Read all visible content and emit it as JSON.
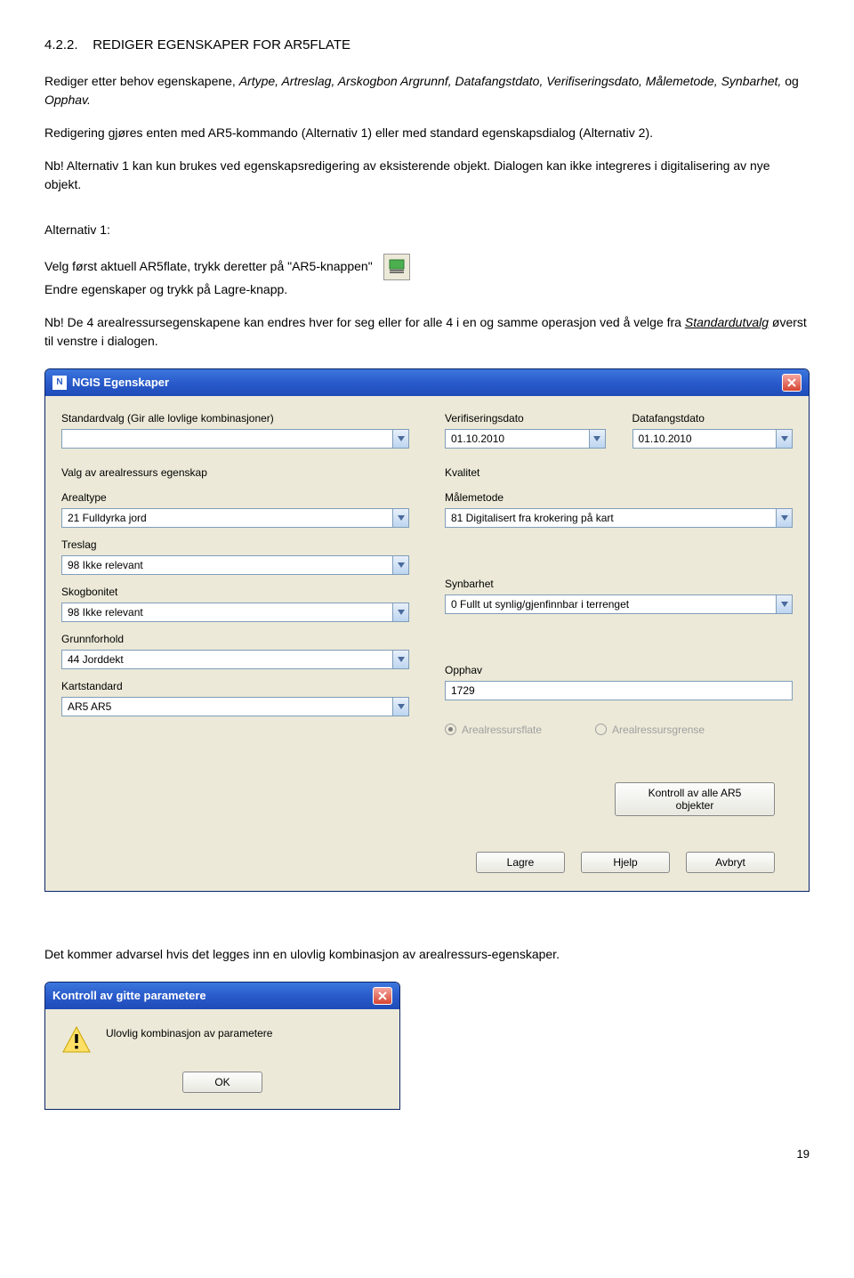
{
  "heading_num": "4.2.2.",
  "heading_text": "REDIGER EGENSKAPER FOR AR5FLATE",
  "para1_a": "Rediger etter behov egenskapene, ",
  "para1_italics": "Artype, Artreslag, Arskogbon Argrunnf, Datafangstdato, Verifiseringsdato, Målemetode, Synbarhet,",
  "para1_b": " og ",
  "para1_c": "Opphav.",
  "para2": "Redigering gjøres enten med AR5-kommando (Alternativ 1) eller med standard egenskapsdialog (Alternativ 2).",
  "para3": "Nb! Alternativ 1 kan kun brukes ved egenskapsredigering av eksisterende objekt. Dialogen kan ikke integreres i digitalisering av nye objekt.",
  "alt1_title": "Alternativ 1:",
  "alt1_line1": "Velg først aktuell AR5flate, trykk deretter på \"AR5-knappen\"",
  "alt1_line2": "Endre egenskaper og trykk på Lagre-knapp.",
  "para4_a": "Nb! De 4 arealressursegenskapene kan endres hver for seg eller for alle 4 i en og samme operasjon ved å velge fra ",
  "para4_u": "Standardutvalg",
  "para4_b": " øverst til venstre i dialogen.",
  "dlg": {
    "title": "NGIS Egenskaper",
    "left": {
      "std_label": "Standardvalg (Gir alle lovlige kombinasjoner)",
      "std_value": "",
      "section": "Valg av arealressurs egenskap",
      "arealtype_label": "Arealtype",
      "arealtype_value": "21 Fulldyrka jord",
      "treslag_label": "Treslag",
      "treslag_value": "98 Ikke relevant",
      "skog_label": "Skogbonitet",
      "skog_value": "98 Ikke relevant",
      "grunn_label": "Grunnforhold",
      "grunn_value": "44 Jorddekt",
      "kart_label": "Kartstandard",
      "kart_value": "AR5      AR5"
    },
    "right": {
      "ver_label": "Verifiseringsdato",
      "ver_value": "01.10.2010",
      "data_label": "Datafangstdato",
      "data_value": "01.10.2010",
      "kval_label": "Kvalitet",
      "maale_label": "Målemetode",
      "maale_value": "81 Digitalisert fra krokering på kart",
      "syn_label": "Synbarhet",
      "syn_value": "0 Fullt ut synlig/gjenfinnbar i terrenget",
      "opphav_label": "Opphav",
      "opphav_value": "1729",
      "radio1": "Arealressursflate",
      "radio2": "Arealressursgrense"
    },
    "kontroll_btn": "Kontroll av alle AR5 objekter",
    "lagre": "Lagre",
    "hjelp": "Hjelp",
    "avbryt": "Avbryt"
  },
  "warn_sentence": "Det kommer advarsel hvis det legges inn en ulovlig kombinasjon av arealressurs-egenskaper.",
  "dlg2": {
    "title": "Kontroll av gitte parametere",
    "msg": "Ulovlig kombinasjon av parametere",
    "ok": "OK"
  },
  "page_num": "19"
}
